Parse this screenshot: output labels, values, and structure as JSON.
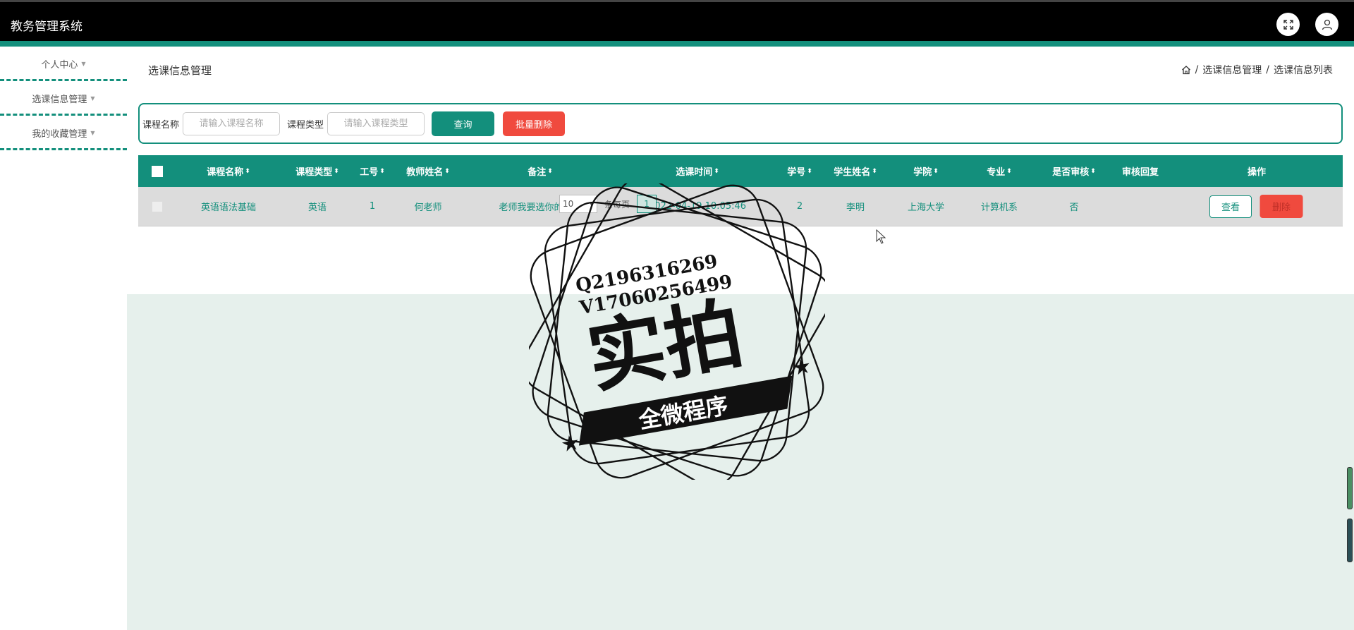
{
  "app": {
    "title": "教务管理系统"
  },
  "icons": {
    "fullscreen": "fullscreen-icon",
    "user": "user-icon",
    "home": "home-icon",
    "caret": "caret-down-icon"
  },
  "colors": {
    "accent": "#138f7c",
    "danger": "#f04a3e",
    "header_bg": "#000000",
    "content_bg": "#e6f0ec"
  },
  "sidebar": {
    "items": [
      {
        "label": "个人中心"
      },
      {
        "label": "选课信息管理"
      },
      {
        "label": "我的收藏管理"
      }
    ]
  },
  "page": {
    "title": "选课信息管理",
    "breadcrumb": [
      "选课信息管理",
      "选课信息列表"
    ],
    "breadcrumb_sep": "/"
  },
  "search": {
    "course_name_label": "课程名称",
    "course_name_placeholder": "请输入课程名称",
    "course_type_label": "课程类型",
    "course_type_placeholder": "请输入课程类型",
    "query_button": "查询",
    "batch_delete_button": "批量删除"
  },
  "table": {
    "sort_glyph": "⬍",
    "columns": [
      "课程名称",
      "课程类型",
      "工号",
      "教师姓名",
      "备注",
      "选课时间",
      "学号",
      "学生姓名",
      "学院",
      "专业",
      "是否审核",
      "审核回复",
      "操作"
    ],
    "rows": [
      {
        "course_name": "英语语法基础",
        "course_type": "英语",
        "work_id": "1",
        "teacher_name": "何老师",
        "remark": "老师我要选你的课程",
        "select_time": "2022-04-19 10:05:46",
        "student_id": "2",
        "student_name": "李明",
        "college": "上海大学",
        "major": "计算机系",
        "reviewed": "否",
        "review_reply": "",
        "view_button": "查看",
        "delete_button": "删除"
      }
    ]
  },
  "pagination": {
    "page_size": "10",
    "per_page_label": "条每页",
    "current_page": "1"
  },
  "watermark": {
    "line1": "Q2196316269",
    "line2": "V17060256499",
    "main": "实拍",
    "banner": "全微程序"
  }
}
